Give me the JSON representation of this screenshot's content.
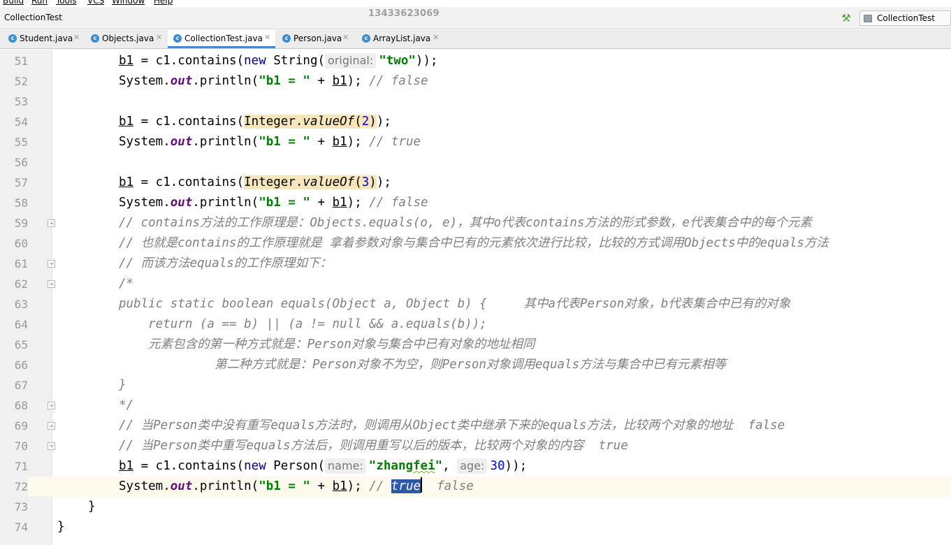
{
  "menu": [
    "Build",
    "Run",
    "Tools",
    "VCS",
    "Window",
    "Help"
  ],
  "project_name": "CollectionTest",
  "watermark": "13433623069",
  "run_config": "CollectionTest",
  "tabs": [
    {
      "label": "Student.java"
    },
    {
      "label": "Objects.java"
    },
    {
      "label": "CollectionTest.java"
    },
    {
      "label": "Person.java"
    },
    {
      "label": "ArrayList.java"
    }
  ],
  "editor": {
    "lines": [
      {
        "n": "51",
        "t": {
          "a": "b1",
          "b": " = c1.contains(",
          "c": "new",
          "d": " String(",
          "hint": "original:",
          "e": "\"two\"",
          "f": "));"
        }
      },
      {
        "n": "52",
        "t": {
          "a": "System.",
          "b": "out",
          "c": ".println(",
          "d": "\"b1 = \"",
          "e": " + ",
          "f": "b1",
          "g": "); ",
          "h": "// false"
        }
      },
      {
        "n": "53"
      },
      {
        "n": "54",
        "t": {
          "a": "b1",
          "b": " = c1.contains(",
          "c": "Integer.",
          "d": "valueOf",
          "e": "(",
          "f": "2",
          "g": ")",
          "h": ");"
        }
      },
      {
        "n": "55",
        "t": {
          "a": "System.",
          "b": "out",
          "c": ".println(",
          "d": "\"b1 = \"",
          "e": " + ",
          "f": "b1",
          "g": "); ",
          "h": "// true"
        }
      },
      {
        "n": "56"
      },
      {
        "n": "57",
        "t": {
          "a": "b1",
          "b": " = c1.contains(",
          "c": "Integer.",
          "d": "valueOf",
          "e": "(",
          "f": "3",
          "g": ")",
          "h": ");"
        }
      },
      {
        "n": "58",
        "t": {
          "a": "System.",
          "b": "out",
          "c": ".println(",
          "d": "\"b1 = \"",
          "e": " + ",
          "f": "b1",
          "g": "); ",
          "h": "// false"
        }
      },
      {
        "n": "59",
        "t": {
          "a": "// contains方法的工作原理是：Objects.equals(o, e)，其中o代表contains方法的形式参数，e代表集合中的每个元素"
        }
      },
      {
        "n": "60",
        "t": {
          "a": "// 也就是contains的工作原理就是 拿着参数对象与集合中已有的元素依次进行比较，比较的方式调用Objects中的equals方法"
        }
      },
      {
        "n": "61",
        "t": {
          "a": "// 而该方法equals的工作原理如下："
        }
      },
      {
        "n": "62",
        "t": {
          "a": "/*"
        }
      },
      {
        "n": "63",
        "t": {
          "a": "public static boolean equals(Object a, Object b) {     其中a代表Person对象，b代表集合中已有的对象"
        }
      },
      {
        "n": "64",
        "t": {
          "a": "    return (a == b) || (a != null && a.equals(b));"
        }
      },
      {
        "n": "65",
        "t": {
          "a": "    元素包含的第一种方式就是：Person对象与集合中已有对象的地址相同"
        }
      },
      {
        "n": "66",
        "t": {
          "a": "             第二种方式就是：Person对象不为空，则Person对象调用equals方法与集合中已有元素相等"
        }
      },
      {
        "n": "67",
        "t": {
          "a": "}"
        }
      },
      {
        "n": "68",
        "t": {
          "a": "*/"
        }
      },
      {
        "n": "69",
        "t": {
          "a": "// 当Person类中没有重写equals方法时，则调用从Object类中继承下来的equals方法，比较两个对象的地址  false"
        }
      },
      {
        "n": "70",
        "t": {
          "a": "// 当Person类中重写equals方法后，则调用重写以后的版本，比较两个对象的内容  true"
        }
      },
      {
        "n": "71",
        "t": {
          "a": "b1",
          "b": " = c1.contains(",
          "c": "new",
          "d": " Person(",
          "hint1": "name:",
          "e": "\"zhang",
          "e2": "fei",
          "e3": "\"",
          "f": ", ",
          "hint2": "age:",
          "g": "30",
          "h": "));"
        }
      },
      {
        "n": "72",
        "t": {
          "a": "System.",
          "b": "out",
          "c": ".println(",
          "d": "\"b1 = \"",
          "e": " + ",
          "f": "b1",
          "g": "); ",
          "h": "// ",
          "sel": "true",
          "i": "  false"
        }
      },
      {
        "n": "73",
        "t": {
          "a": "}"
        }
      },
      {
        "n": "74",
        "t": {
          "a": "}"
        }
      }
    ]
  }
}
